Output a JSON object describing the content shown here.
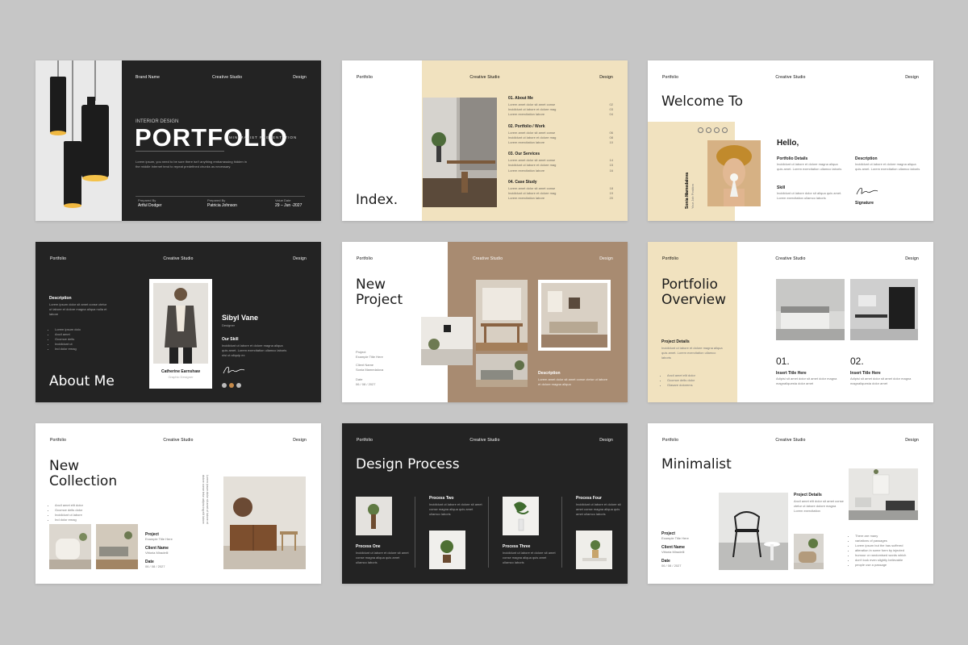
{
  "colors": {
    "background": "#c6c6c6",
    "dark": "#232323",
    "cream": "#f1e2bf",
    "tan": "#a88b71"
  },
  "s1": {
    "brand": "Brand Name",
    "studio": "Creative Studio",
    "design": "Design",
    "kicker": "INTERIOR DESIGN",
    "title": "PORTFOLIO",
    "sub": "MINIMALIST PRESENTATION",
    "body": "Lorem ipsum, you need to be sure there isn't anything embarrassing hidden in the middle Internet tend to repeat predefined chunks as necessary.",
    "prepared_by": "Prepared By",
    "p1": "Artful Dodger",
    "prepared_by2": "Prepared By",
    "p2": "Patricia Johnson",
    "value_date": "Value Date",
    "date": "29 – Jun -2027"
  },
  "s2": {
    "portfolio": "Portfolio",
    "studio": "Creative Studio",
    "design": "Design",
    "title": "Index.",
    "items": [
      {
        "title": "01. About Me",
        "lines": [
          "Lorem amet dolor sit amet conse",
          "Incididunt ut labore et dolore mag",
          "Lorem exercitation labore"
        ],
        "nums": [
          "02",
          "03",
          "04"
        ]
      },
      {
        "title": "02. Portfolio / Work",
        "lines": [
          "Lorem amet dolor sit amet conse",
          "Incididunt ut labore et dolore mag",
          "Lorem exercitation labore"
        ],
        "nums": [
          "06",
          "08",
          "10"
        ]
      },
      {
        "title": "03. Our Services",
        "lines": [
          "Lorem amet dolor sit amet conse",
          "Incididunt ut labore et dolore mag",
          "Lorem exercitation labore"
        ],
        "nums": [
          "14",
          "15",
          "16"
        ]
      },
      {
        "title": "04. Case Study",
        "lines": [
          "Lorem amet dolor sit amet conse",
          "Incididunt ut labore et dolore mag",
          "Lorem exercitation labore"
        ],
        "nums": [
          "18",
          "19",
          "20"
        ]
      }
    ]
  },
  "s3": {
    "portfolio": "Portfolio",
    "studio": "Creative Studio",
    "design": "Design",
    "title": "Welcome To",
    "hello": "Hello,",
    "name": "Sonia Mamedalova",
    "role": "Your Job Position",
    "details": "Portfolio Details",
    "details_text": "Incididunt ut labore et dolore magna aliqua quis amet. Lorem exercitation ullamco laboris",
    "skill": "Skill",
    "skill_text": "Incididunt ut labore dolor sit aliqua quis amet. Lorem exercitation ullamco laboris",
    "desc": "Description",
    "desc_text": "Incididunt ut labore et dolore magna aliqua quis amet. Lorem exercitation ullamco laboris",
    "signature": "Signature"
  },
  "s4": {
    "portfolio": "Portfolio",
    "studio": "Creative Studio",
    "design": "Design",
    "desc": "Description",
    "desc_text": "Lorem ipsum dolor sit amet conse ctetur ut labore et dolore magna aliqua nulla et labore",
    "bullets": [
      "Lorem ipsum dolo",
      "Ancil amet",
      "Gcomce delis",
      "Incididunt ut",
      "Ind dolor emag"
    ],
    "title": "About Me",
    "card_name": "Catherine Earnshaw",
    "card_role": "Graphic Designer",
    "name": "Sibyl Vane",
    "role": "Designer",
    "skill": "Our Skill",
    "skill_text": "Incididunt ut labore et dolore magna aliqua quis amet. Lorem exercitation ullamco laboris nisi ut aliquip ex"
  },
  "s5": {
    "portfolio": "Portfolio",
    "studio": "Creative Studio",
    "design": "Design",
    "title": "New Project",
    "project": "Project",
    "project_v": "Example Title Here",
    "client": "Client Name",
    "client_v": "Sonia Mamedalova",
    "date": "Date",
    "date_v": "06 / 08 / 2027",
    "desc": "Description",
    "desc_text": "Lorem amet dolor sit amet conse ctetur ut labore et dolore magna aliqua"
  },
  "s6": {
    "portfolio": "Portfolio",
    "studio": "Creative Studio",
    "design": "Design",
    "title": "Portfolio Overview",
    "details": "Project Details",
    "details_text": "Incididunt ut labore et dolore magna aliqua quis amet. Lorem exercitation ullamco laboris",
    "bullets": [
      "Ancil amet elit dolor",
      "Gcomce delis dolor",
      "Glasare dolorems"
    ],
    "n1": "01.",
    "n2": "02.",
    "insert": "Insert Title Here",
    "insert_text": "Adipisi sit amet dolor sit amet dolor magna magnaliquesta dolor amet"
  },
  "s7": {
    "portfolio": "Portfolio",
    "studio": "Creative Studio",
    "design": "Design",
    "title": "New Collection",
    "bullets": [
      "Ancil amet elit dolor",
      "Gcomce delis dolor",
      "Incididunt ut labore",
      "Ind dolor emag"
    ],
    "project": "Project",
    "project_v": "Example Title Here",
    "client": "Client Name",
    "client_v": "Vittoria Miradelli",
    "date": "Date",
    "date_v": "06 / 08 / 2027",
    "vertical": "Lorem ipsum dolor sit amet of labore et dolore conse tetur adipiscing elit labore"
  },
  "s8": {
    "portfolio": "Portfolio",
    "studio": "Creative Studio",
    "design": "Design",
    "title": "Design Process",
    "steps": [
      {
        "title": "Process One",
        "text": "Incididunt ut labore et dolore sit amet conse magna aliqua quis amet ullamco laboris"
      },
      {
        "title": "Process Two",
        "text": "Incididunt ut labore et dolore sit amet conse magna aliqua quis amet ullamco laboris"
      },
      {
        "title": "Process Three",
        "text": "Incididunt ut labore et dolore sit amet conse magna aliqua quis amet ullamco laboris"
      },
      {
        "title": "Process Four",
        "text": "Incididunt ut labore et dolore sit amet conse magna aliqua quis amet ullamco laboris"
      }
    ]
  },
  "s9": {
    "portfolio": "Portfolio",
    "studio": "Creative Studio",
    "design": "Design",
    "title": "Minimalist",
    "details": "Project Details",
    "details_text": "Ancil amet elit dolor sit amet conse ctetur ut labore dolore magna Lorem exercitation",
    "project": "Project",
    "project_v": "Example Title Here",
    "client": "Client Name",
    "client_v": "Vittoria Miradelli",
    "date": "Date",
    "date_v": "06 / 08 / 2027",
    "bullets": [
      "There are many",
      "variations of passages",
      "Lorem ipsum but the has suffered",
      "alteration in some form by injected",
      "humour or randomised words which",
      "don't look even slightly believable",
      "people use a passage"
    ]
  }
}
